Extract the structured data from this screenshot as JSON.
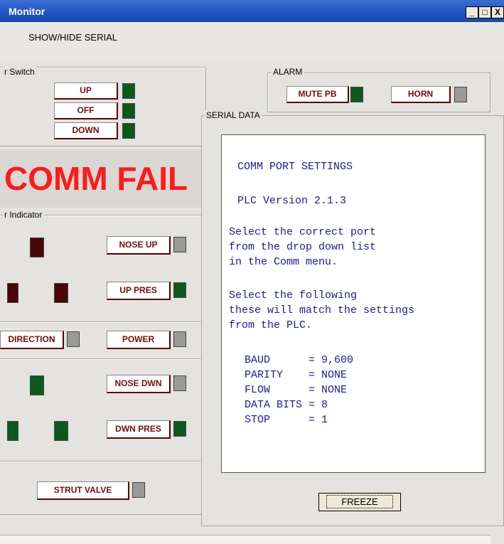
{
  "window": {
    "title": "Monitor",
    "btn_min": "_",
    "btn_max": "□",
    "btn_close": "X"
  },
  "menu": {
    "show_hide_serial": "SHOW/HIDE SERIAL"
  },
  "switch_group": {
    "label": "r Switch",
    "up": "UP",
    "off": "OFF",
    "down": "DOWN"
  },
  "alarm_group": {
    "label": "ALARM",
    "mute": "MUTE PB",
    "horn": "HORN"
  },
  "comm_fail": "COMM FAIL",
  "indicator_group": {
    "label": "r Indicator",
    "nose_up": "NOSE UP",
    "up_pres": "UP PRES",
    "direction": "DIRECTION",
    "power": "POWER",
    "nose_dwn": "NOSE DWN",
    "dwn_pres": "DWN PRES",
    "strut_valve": "STRUT VALVE"
  },
  "serial": {
    "label": "SERIAL DATA",
    "lines": [
      "COMM PORT SETTINGS",
      "PLC Version 2.1.3",
      "Select the correct port",
      "from the drop down list",
      "in the Comm menu.",
      "Select the following",
      "these will match the settings",
      "from the PLC.",
      "BAUD      = 9,600",
      "PARITY    = NONE",
      "FLOW      = NONE",
      "DATA BITS = 8",
      "STOP      = 1"
    ],
    "freeze": "FREEZE"
  },
  "colors": {
    "lamp_green": "#0b5a1c",
    "lamp_gray": "#9a9a9a",
    "lamp_darkred": "#4a0508",
    "comm_fail_red": "#ff1a1a",
    "serial_text": "#1a1aa0"
  }
}
